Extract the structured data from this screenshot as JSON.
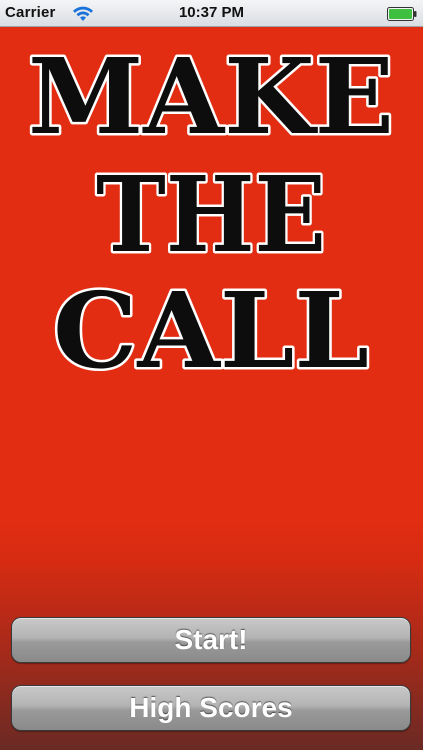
{
  "status_bar": {
    "carrier": "Carrier",
    "time": "10:37 PM",
    "wifi_icon": "wifi-icon",
    "battery_icon": "battery-icon",
    "battery_color": "#3fbf3f"
  },
  "title": {
    "line1": "MAKE",
    "line2": "THE",
    "line3": "CALL"
  },
  "buttons": {
    "start_label": "Start!",
    "high_scores_label": "High Scores"
  },
  "colors": {
    "background": "#e22d12",
    "title_fill": "#0d0d0d",
    "title_outline": "#ffffff",
    "button": "#a8a8a8"
  }
}
